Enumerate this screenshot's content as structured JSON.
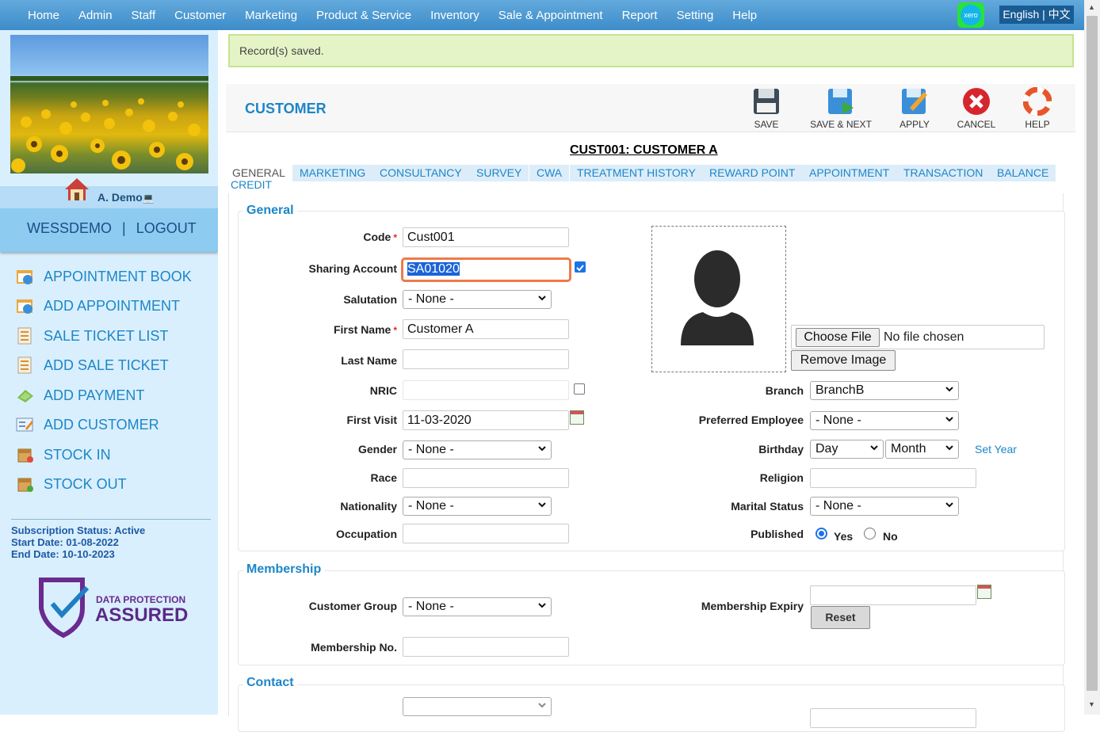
{
  "topnav": {
    "items": [
      "Home",
      "Admin",
      "Staff",
      "Customer",
      "Marketing",
      "Product & Service",
      "Inventory",
      "Sale & Appointment",
      "Report",
      "Setting",
      "Help"
    ],
    "xero_label": "xero",
    "language": "English | 中文"
  },
  "sidebar": {
    "username": "A. Demo",
    "company": "WESSDEMO",
    "separator": "|",
    "logout": "LOGOUT",
    "links": [
      {
        "label": "APPOINTMENT BOOK",
        "icon": "calendar-icon"
      },
      {
        "label": "ADD APPOINTMENT",
        "icon": "calendar-add-icon"
      },
      {
        "label": "SALE TICKET LIST",
        "icon": "ticket-list-icon"
      },
      {
        "label": "ADD SALE TICKET",
        "icon": "ticket-add-icon"
      },
      {
        "label": "ADD PAYMENT",
        "icon": "payment-icon"
      },
      {
        "label": "ADD CUSTOMER",
        "icon": "customer-add-icon"
      },
      {
        "label": "STOCK IN",
        "icon": "stock-in-icon"
      },
      {
        "label": "STOCK OUT",
        "icon": "stock-out-icon"
      }
    ],
    "subscription": {
      "status": "Subscription Status: Active",
      "start": "Start Date: 01-08-2022",
      "end": "End Date: 10-10-2023"
    },
    "badge": {
      "line1": "DATA PROTECTION",
      "line2": "ASSURED"
    }
  },
  "main": {
    "saved_message": "Record(s) saved.",
    "page_title": "CUSTOMER",
    "toolbar": {
      "save": "SAVE",
      "save_next": "SAVE & NEXT",
      "apply": "APPLY",
      "cancel": "CANCEL",
      "help": "HELP"
    },
    "record_title": "CUST001: CUSTOMER A",
    "tabs": [
      "GENERAL",
      "MARKETING",
      "CONSULTANCY",
      "SURVEY",
      "CWA",
      "TREATMENT HISTORY",
      "REWARD POINT",
      "APPOINTMENT",
      "TRANSACTION",
      "BALANCE",
      "CREDIT"
    ],
    "general": {
      "legend": "General",
      "code_label": "Code",
      "code_value": "Cust001",
      "sharing_label": "Sharing Account",
      "sharing_value": "SA01020",
      "sharing_checked": true,
      "salutation_label": "Salutation",
      "salutation_value": "- None -",
      "first_name_label": "First Name",
      "first_name_value": "Customer A",
      "last_name_label": "Last Name",
      "last_name_value": "",
      "nric_label": "NRIC",
      "nric_value": "",
      "first_visit_label": "First Visit",
      "first_visit_value": "11-03-2020",
      "gender_label": "Gender",
      "gender_value": "- None -",
      "race_label": "Race",
      "race_value": "",
      "nationality_label": "Nationality",
      "nationality_value": "- None -",
      "occupation_label": "Occupation",
      "occupation_value": "",
      "choose_file": "Choose File",
      "no_file": "No file chosen",
      "remove_image": "Remove Image",
      "branch_label": "Branch",
      "branch_value": "BranchB",
      "pref_employee_label": "Preferred Employee",
      "pref_employee_value": "- None -",
      "birthday_label": "Birthday",
      "birthday_day": "Day",
      "birthday_month": "Month",
      "set_year": "Set Year",
      "religion_label": "Religion",
      "religion_value": "",
      "marital_label": "Marital Status",
      "marital_value": "- None -",
      "published_label": "Published",
      "published_yes": "Yes",
      "published_no": "No"
    },
    "membership": {
      "legend": "Membership",
      "group_label": "Customer Group",
      "group_value": "- None -",
      "number_label": "Membership No.",
      "number_value": "",
      "expiry_label": "Membership Expiry",
      "expiry_value": "",
      "reset": "Reset"
    },
    "contact": {
      "legend": "Contact"
    }
  },
  "colors": {
    "accent": "#1d86c8",
    "topnav": "#4a97d0",
    "sidebar": "#d9effd",
    "saved_bg": "#e4f4c6",
    "focus": "#ef7a4a"
  }
}
